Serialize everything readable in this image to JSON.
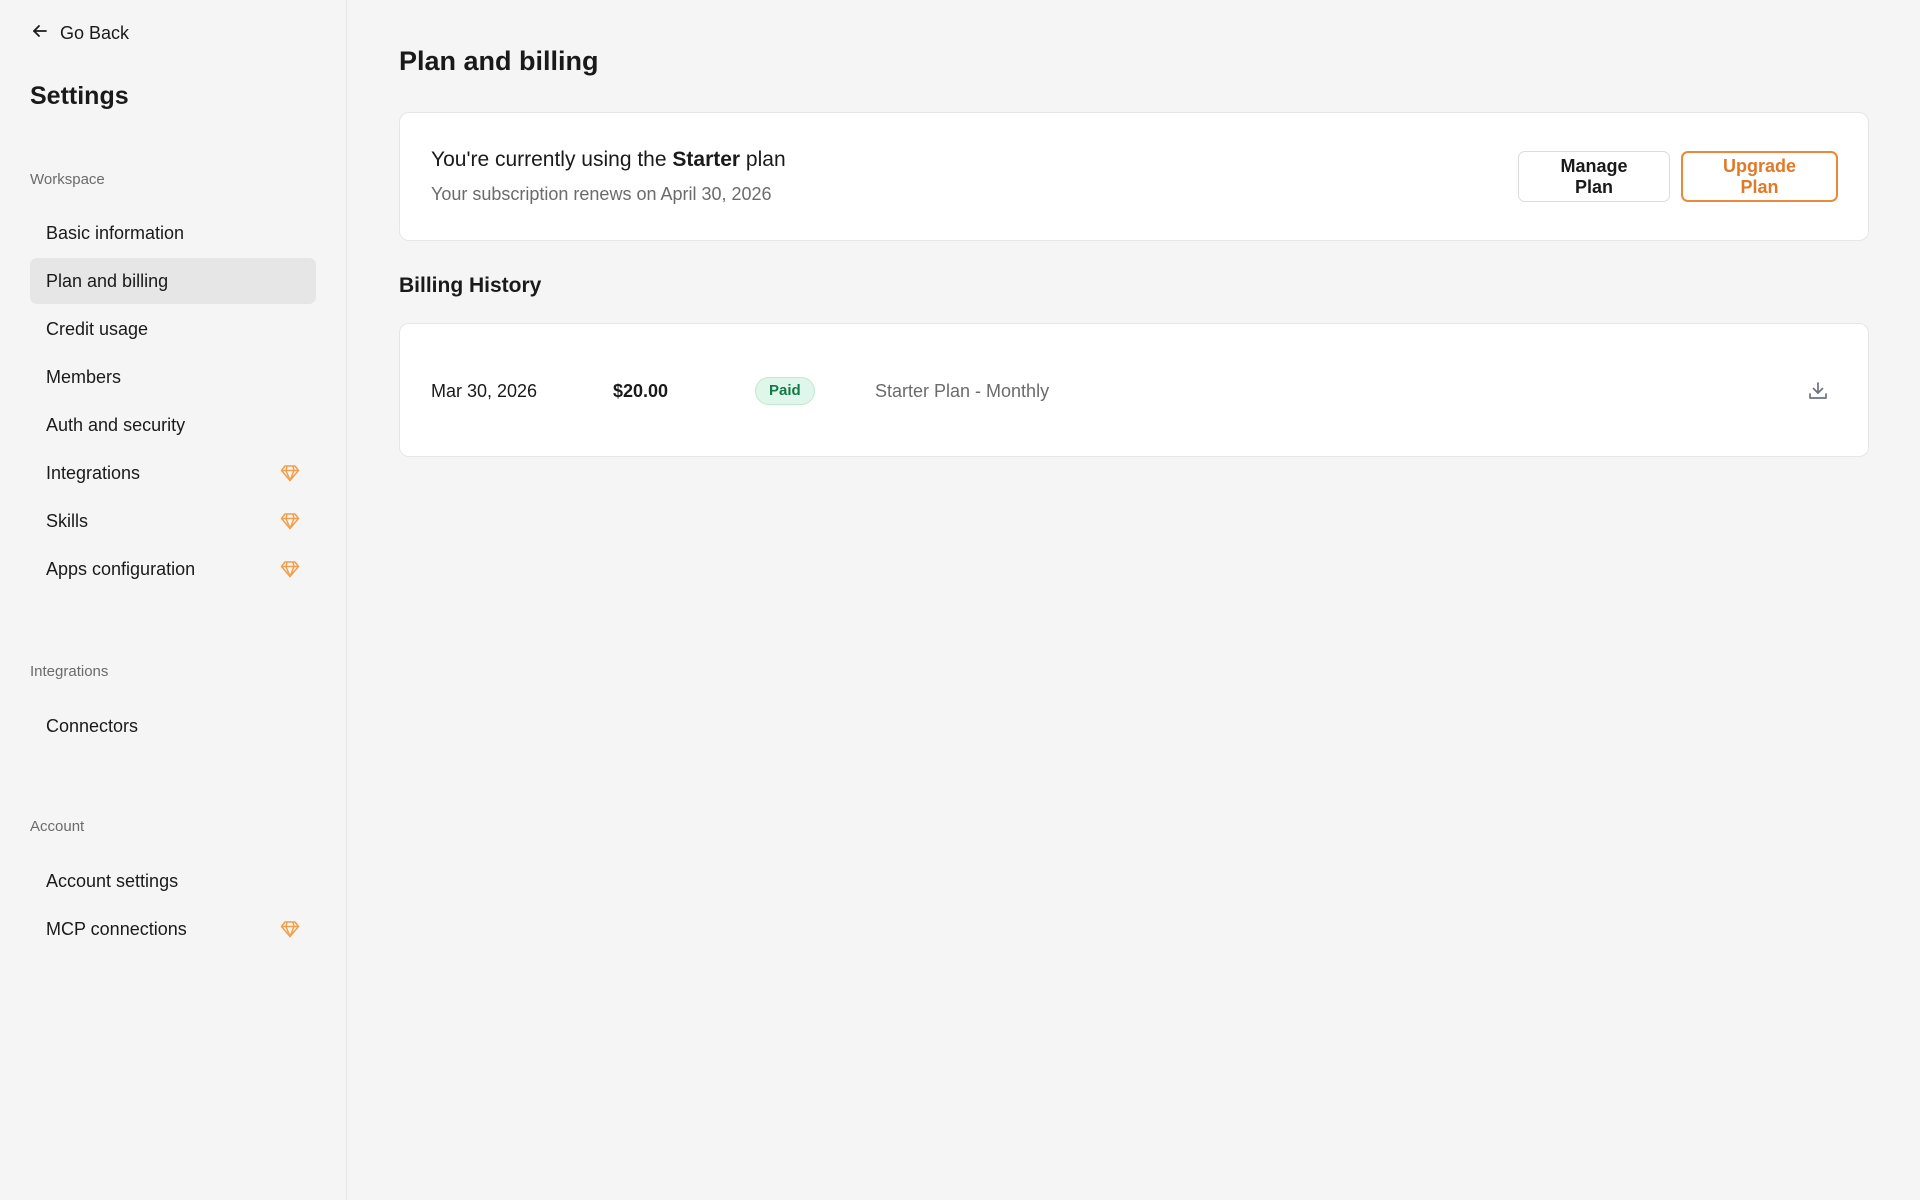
{
  "sidebar": {
    "go_back": "Go Back",
    "title": "Settings",
    "sections": {
      "workspace": {
        "label": "Workspace",
        "items": [
          {
            "label": "Basic information",
            "premium": false
          },
          {
            "label": "Plan and billing",
            "premium": false,
            "active": true
          },
          {
            "label": "Credit usage",
            "premium": false
          },
          {
            "label": "Members",
            "premium": false
          },
          {
            "label": "Auth and security",
            "premium": false
          },
          {
            "label": "Integrations",
            "premium": true
          },
          {
            "label": "Skills",
            "premium": true
          },
          {
            "label": "Apps configuration",
            "premium": true
          }
        ]
      },
      "integrations": {
        "label": "Integrations",
        "items": [
          {
            "label": "Connectors",
            "premium": false
          }
        ]
      },
      "account": {
        "label": "Account",
        "items": [
          {
            "label": "Account settings",
            "premium": false
          },
          {
            "label": "MCP connections",
            "premium": true
          }
        ]
      }
    }
  },
  "main": {
    "title": "Plan and billing",
    "plan": {
      "prefix": "You're currently using the ",
      "plan_name": "Starter",
      "suffix": " plan",
      "renewal": "Your subscription renews on April 30, 2026",
      "manage_label": "Manage Plan",
      "upgrade_label": "Upgrade Plan"
    },
    "billing_history": {
      "title": "Billing History",
      "rows": [
        {
          "date": "Mar 30, 2026",
          "amount": "$20.00",
          "status": "Paid",
          "description": "Starter Plan - Monthly"
        }
      ]
    }
  },
  "colors": {
    "accent": "#e07a28",
    "paid_badge_bg": "#dff6ea",
    "paid_badge_text": "#137a47",
    "gem": "#f0a04b"
  },
  "icons": {
    "back": "arrow-left-icon",
    "premium": "gem-icon",
    "download": "download-icon"
  }
}
